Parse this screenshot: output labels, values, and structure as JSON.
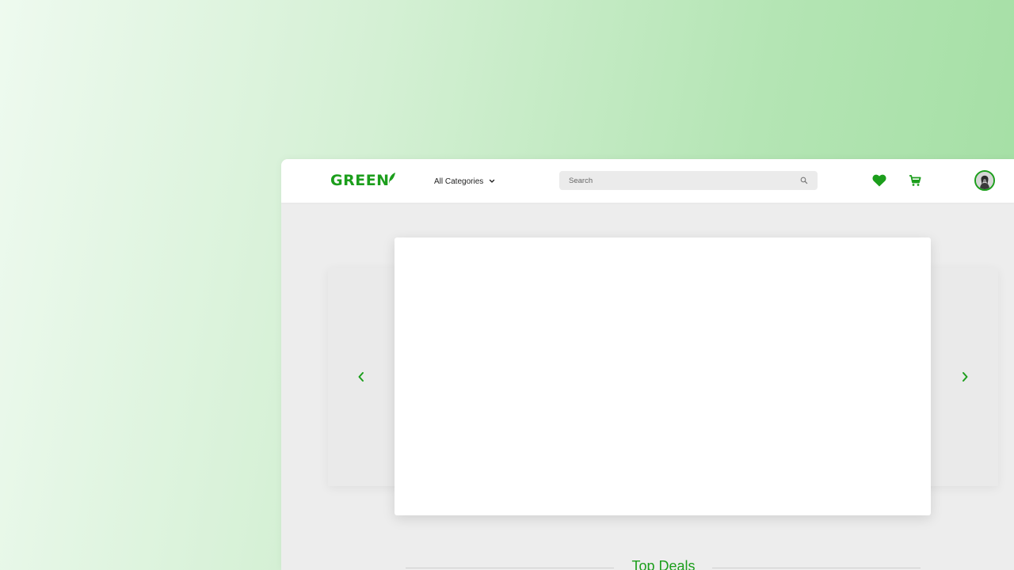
{
  "brand": {
    "name": "GREEN",
    "color": "#1c9e1c"
  },
  "navbar": {
    "categories_label": "All Categories",
    "search_placeholder": "Search",
    "icons": [
      "heart-icon",
      "cart-icon",
      "search-icon",
      "chevron-down-icon"
    ]
  },
  "carousel": {
    "prev_icon": "chevron-left-icon",
    "next_icon": "chevron-right-icon"
  },
  "sections": {
    "top_deals_title": "Top Deals"
  }
}
